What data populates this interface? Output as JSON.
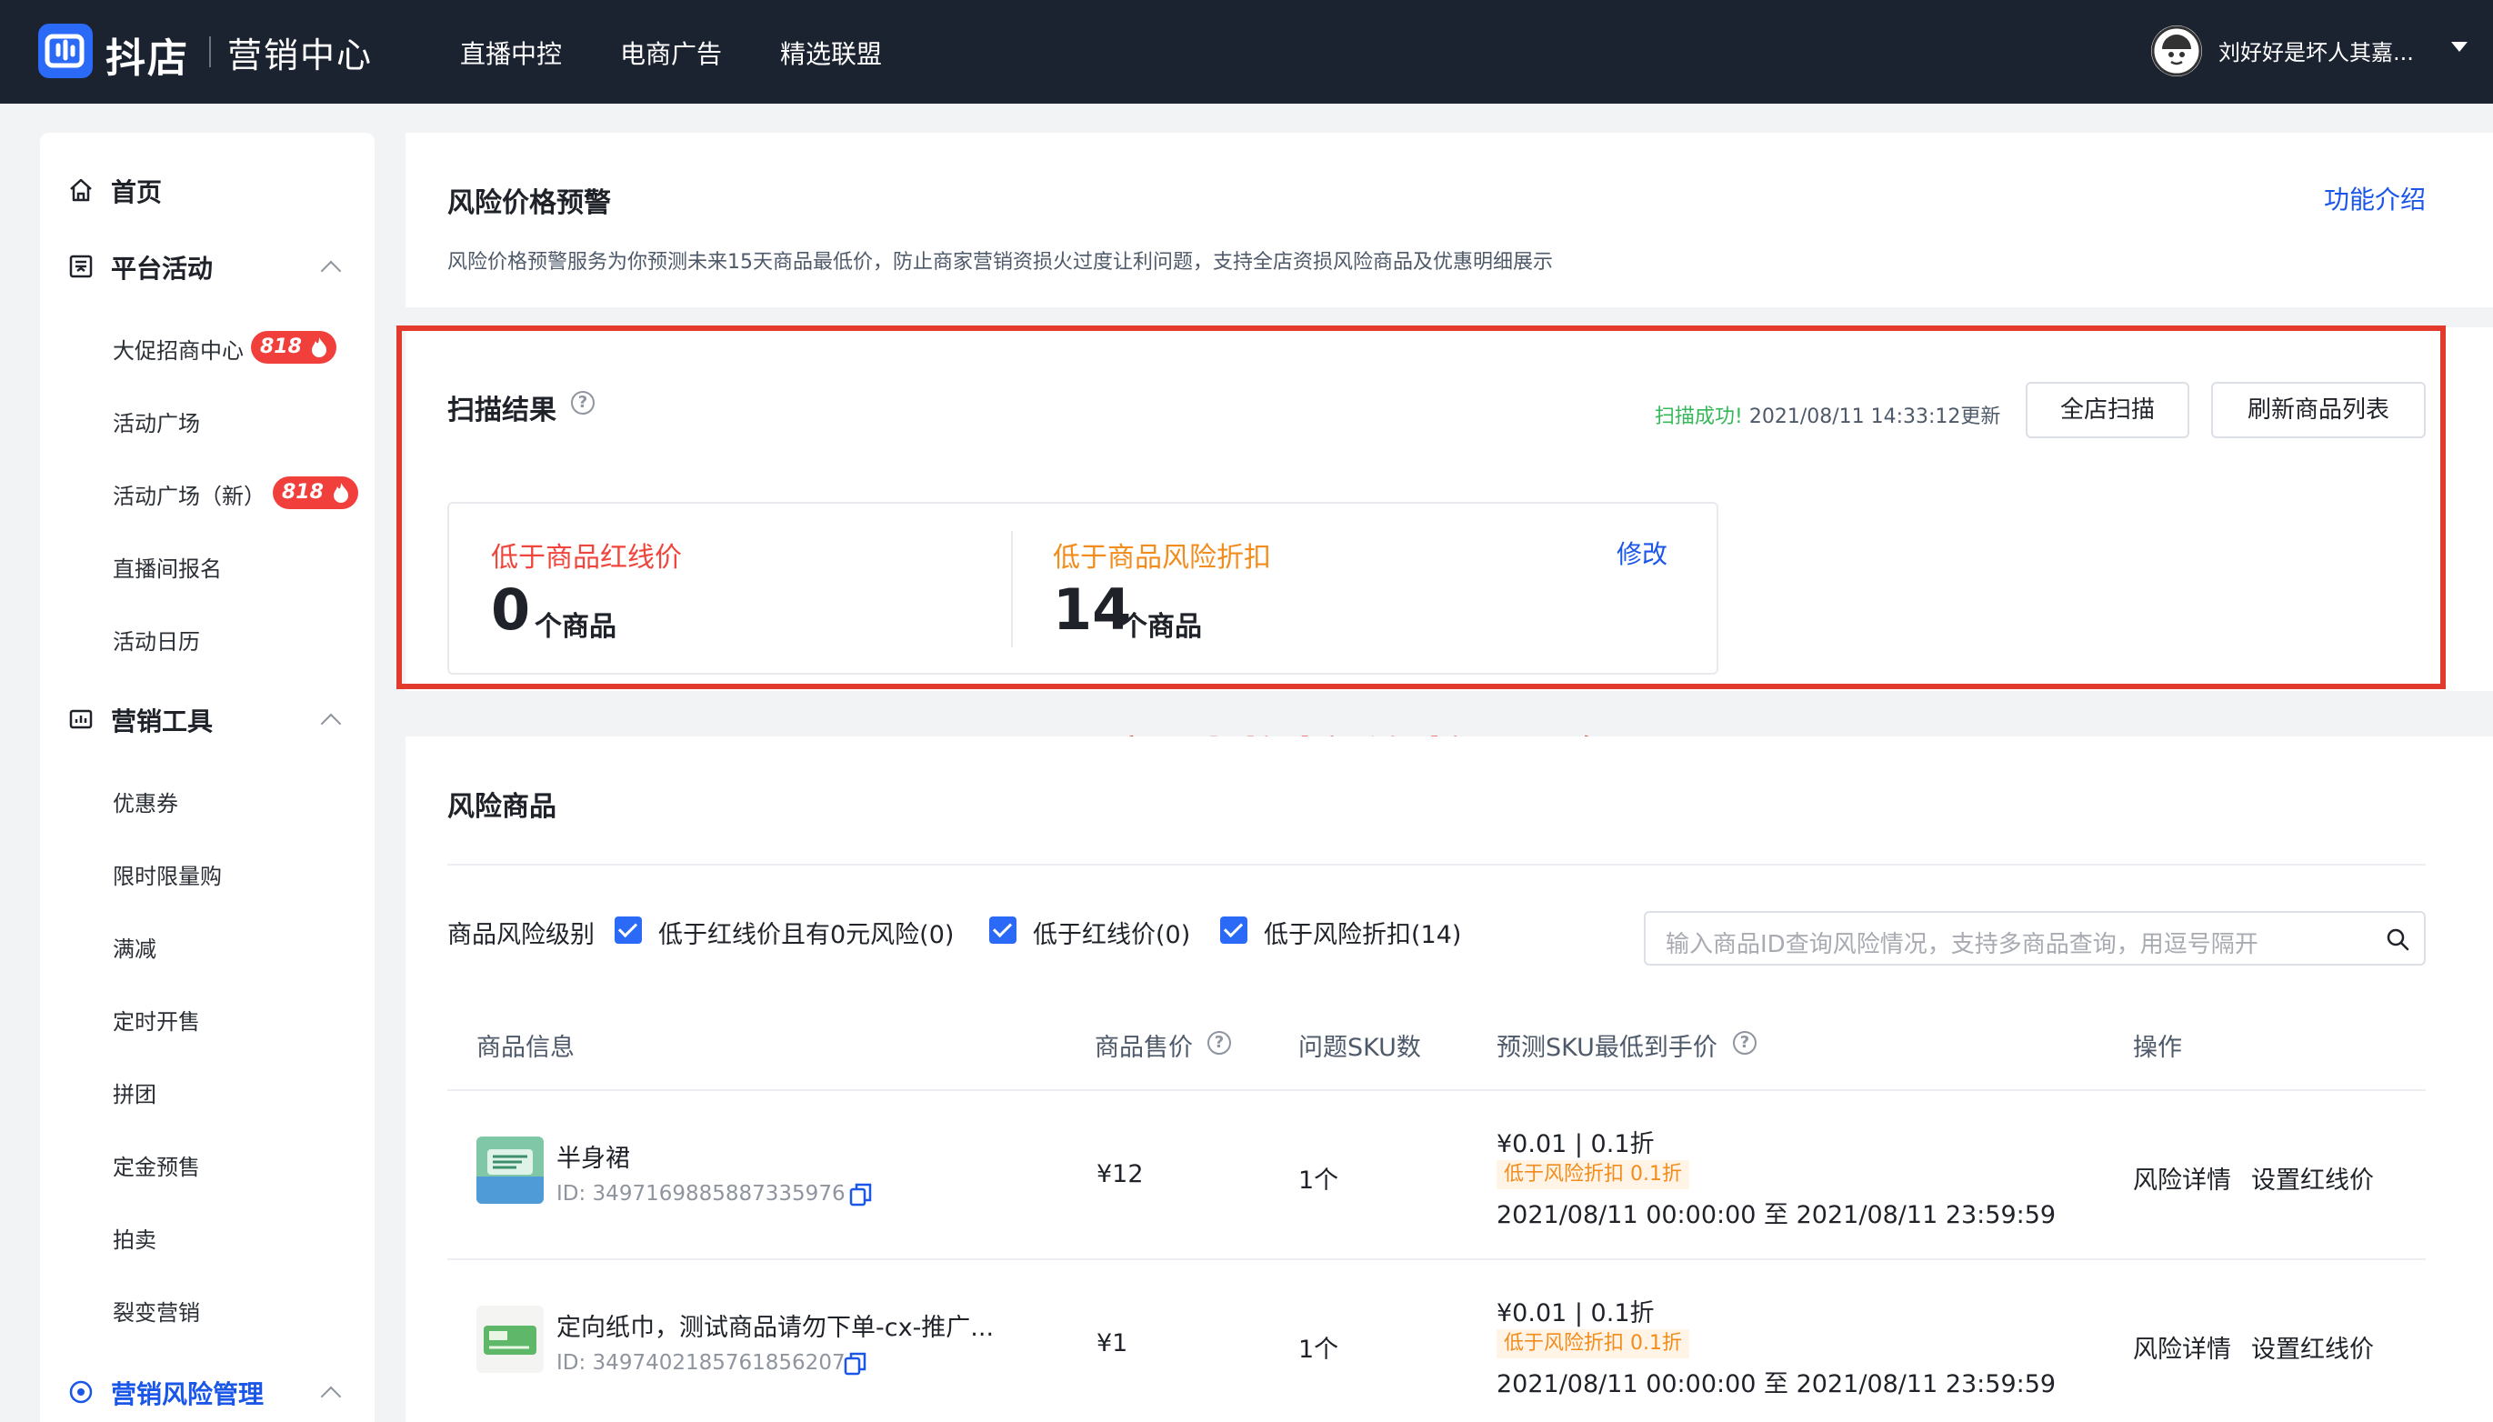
{
  "topbar": {
    "brand": "抖店",
    "brand_sub": "营销中心",
    "nav": [
      "直播中控",
      "电商广告",
      "精选联盟"
    ],
    "user_name": "刘好好是坏人其嘉..."
  },
  "sidebar": {
    "home": "首页",
    "platform_activity": "平台活动",
    "platform_items": [
      "大促招商中心",
      "活动广场",
      "活动广场（新）",
      "直播间报名",
      "活动日历"
    ],
    "badge_818": "818",
    "marketing_tools": "营销工具",
    "tool_items": [
      "优惠券",
      "限时限量购",
      "满减",
      "定时开售",
      "拼团",
      "定金预售",
      "拍卖",
      "裂变营销"
    ],
    "risk_mgmt": "营销风险管理"
  },
  "header_card": {
    "title": "风险价格预警",
    "intro_link": "功能介绍",
    "description": "风险价格预警服务为你预测未来15天商品最低价，防止商家营销资损火过度让利问题，支持全店资损风险商品及优惠明细展示"
  },
  "scan": {
    "title": "扫描结果",
    "status_ok": "扫描成功!",
    "status_time": "2021/08/11 14:33:12更新",
    "btn_full_scan": "全店扫描",
    "btn_refresh": "刷新商品列表",
    "below_redline_label": "低于商品红线价",
    "below_redline_count": "0",
    "below_discount_label": "低于商品风险折扣",
    "below_discount_count": "14",
    "unit": "个商品",
    "edit_link": "修改"
  },
  "annotation": "实时监控价格风险",
  "risk_goods": {
    "title": "风险商品",
    "filter_label": "商品风险级别",
    "filters": [
      "低于红线价且有0元风险(0)",
      "低于红线价(0)",
      "低于风险折扣(14)"
    ],
    "search_placeholder": "输入商品ID查询风险情况，支持多商品查询，用逗号隔开",
    "columns": [
      "商品信息",
      "商品售价",
      "问题SKU数",
      "预测SKU最低到手价",
      "操作"
    ],
    "rows": [
      {
        "name": "半身裙",
        "id": "ID: 3497169885887335976",
        "price": "¥12",
        "sku_count": "1个",
        "lowest": "¥0.01 | 0.1折",
        "tag": "低于风险折扣 0.1折",
        "period": "2021/08/11 00:00:00 至 2021/08/11 23:59:59",
        "action_detail": "风险详情",
        "action_set": "设置红线价"
      },
      {
        "name": "定向纸巾，测试商品请勿下单-cx-推广...",
        "id": "ID: 3497402185761856207",
        "price": "¥1",
        "sku_count": "1个",
        "lowest": "¥0.01 | 0.1折",
        "tag": "低于风险折扣 0.1折",
        "period": "2021/08/11 00:00:00 至 2021/08/11 23:59:59",
        "action_detail": "风险详情",
        "action_set": "设置红线价"
      }
    ]
  }
}
